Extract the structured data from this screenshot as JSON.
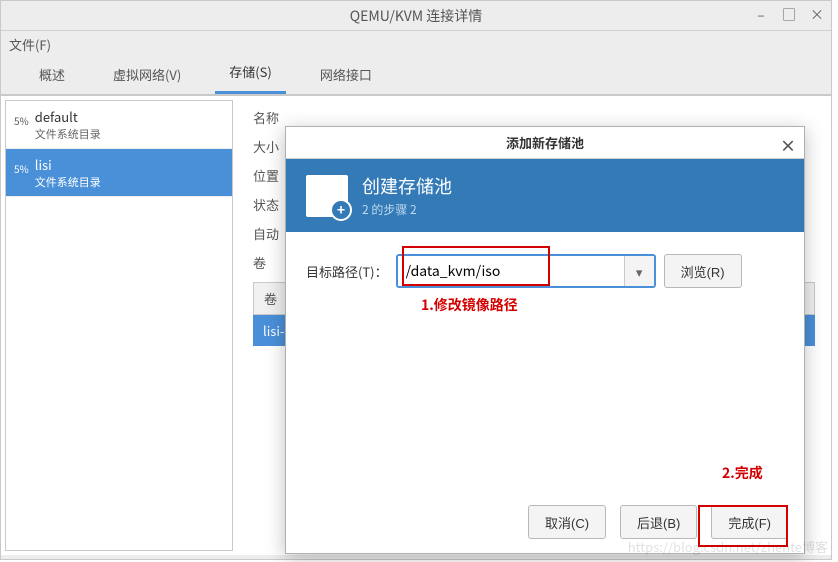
{
  "window": {
    "title": "QEMU/KVM 连接详情"
  },
  "menubar": {
    "file": "文件(F)"
  },
  "tabs": {
    "overview": "概述",
    "vnet": "虚拟网络(V)",
    "storage": "存储(S)",
    "netif": "网络接口"
  },
  "pools": [
    {
      "pct": "5%",
      "name": "default",
      "sub": "文件系统目录"
    },
    {
      "pct": "5%",
      "name": "lisi",
      "sub": "文件系统目录"
    }
  ],
  "detail_labels": {
    "name": "名称",
    "size": "大小",
    "location": "位置",
    "state": "状态",
    "autostart": "自动",
    "vol": "卷"
  },
  "vol_table": {
    "header": "卷",
    "row0": "lisi-"
  },
  "dialog": {
    "title": "添加新存储池",
    "header_title": "创建存储池",
    "header_sub": "2 的步骤 2",
    "path_label": "目标路径(T)：",
    "path_value": "/data_kvm/iso",
    "browse": "浏览(R)",
    "cancel": "取消(C)",
    "back": "后退(B)",
    "finish": "完成(F)"
  },
  "annotations": {
    "a1": "1.修改镜像路径",
    "a2": "2.完成"
  },
  "watermark": "https://blog.csdn.net/zhente博客"
}
